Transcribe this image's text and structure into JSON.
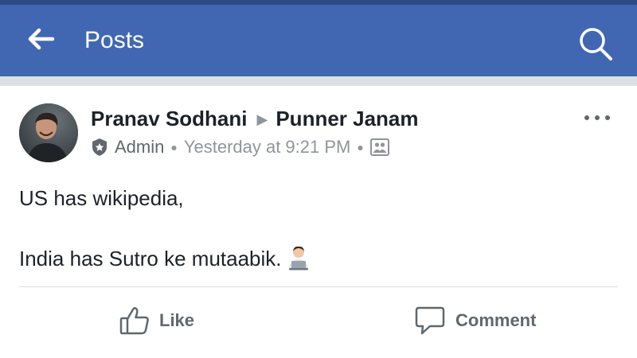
{
  "appbar": {
    "title": "Posts",
    "back_icon": "arrow-left-icon",
    "search_icon": "search-icon",
    "color": "#4267b2"
  },
  "post": {
    "author": "Pranav Sodhani",
    "group": "Punner Janam",
    "role": "Admin",
    "timestamp": "Yesterday at 9:21 PM",
    "audience_icon": "group-photo-icon",
    "more_icon": "more-dots-icon",
    "body": {
      "line1": "US has wikipedia,",
      "line2": "India has Sutro ke mutaabik."
    },
    "emoji_icon": "technologist-emoji-icon"
  },
  "actions": {
    "like_label": "Like",
    "comment_label": "Comment"
  }
}
